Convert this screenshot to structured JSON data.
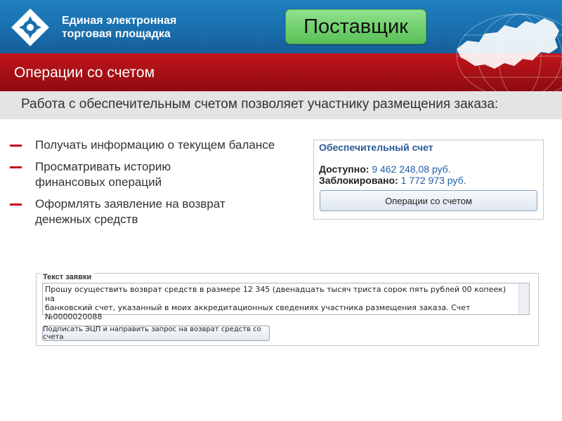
{
  "header": {
    "brand_line1": "Единая электронная",
    "brand_line2": "торговая площадка",
    "role_badge": "Поставщик",
    "logo_icon": "eets-logo-icon",
    "map_icon": "russia-map-icon",
    "colors": {
      "top": "#1a6fae",
      "title_bar": "#a30f14",
      "badge": "#6fcf6b"
    }
  },
  "title": "Операции со счетом",
  "subtitle": "Работа с обеспечительным счетом позволяет участнику размещения заказа:",
  "bullets": [
    {
      "text": "Получать информацию о текущем балансе"
    },
    {
      "text": "Просматривать историю\nфинансовых операций"
    },
    {
      "text": "Оформлять заявление на возврат\nденежных средств"
    }
  ],
  "account": {
    "title": "Обеспечительный счет",
    "available_label": "Доступно:",
    "available_value": "9 462 248,08 руб.",
    "blocked_label": "Заблокировано:",
    "blocked_value": "1 772 973 руб.",
    "button": "Операции со счетом"
  },
  "request": {
    "legend": "Текст заявки",
    "text": "Прошу осуществить возврат средств в размере 12 345 (двенадцать тысяч триста сорок пять рублей  00 копеек) на\nбанковский счет, указанный в моих аккредитационных сведениях участника размещения заказа. Счет №0000020088",
    "button": "Подписать ЭЦП и направить запрос на возврат средств со счета"
  }
}
